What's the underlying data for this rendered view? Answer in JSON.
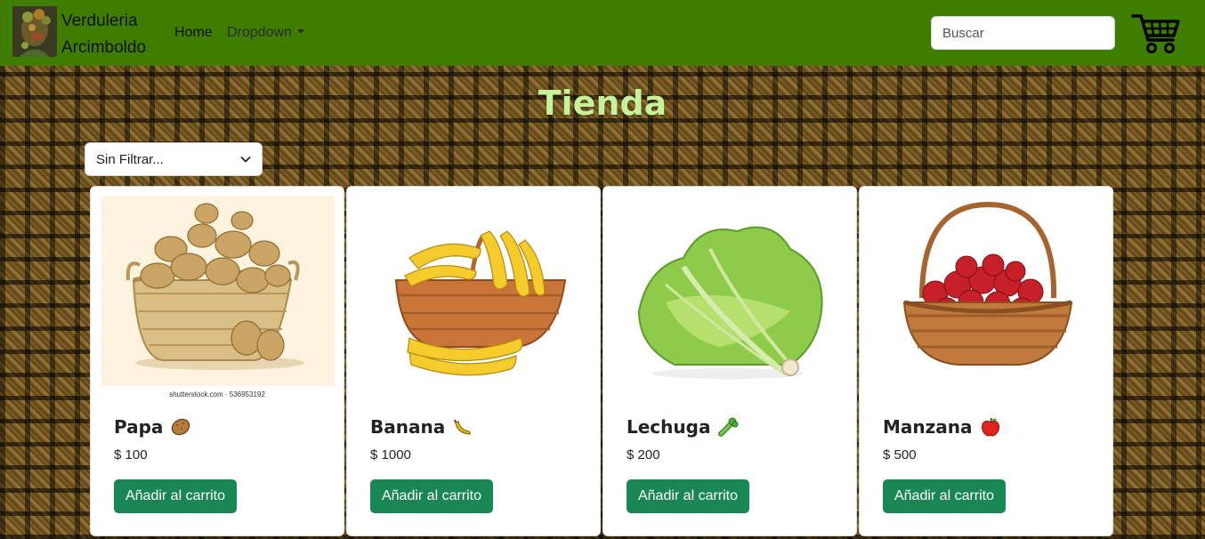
{
  "navbar": {
    "brand_line1": "Verduleria",
    "brand_line2": "Arcimboldo",
    "home_label": "Home",
    "dropdown_label": "Dropdown",
    "search_placeholder": "Buscar",
    "background_color": "#3f7d00"
  },
  "main": {
    "title": "Tienda",
    "filter_selected": "Sin Filtrar...",
    "image_watermark": "shutterstock.com · 536953192"
  },
  "products": [
    {
      "name": "Papa",
      "emoji_icon": "potato-icon",
      "price": "$ 100",
      "button_label": "Añadir al carrito"
    },
    {
      "name": "Banana",
      "emoji_icon": "banana-icon",
      "price": "$ 1000",
      "button_label": "Añadir al carrito"
    },
    {
      "name": "Lechuga",
      "emoji_icon": "celery-icon",
      "price": "$ 200",
      "button_label": "Añadir al carrito"
    },
    {
      "name": "Manzana",
      "emoji_icon": "apple-icon",
      "price": "$ 500",
      "button_label": "Añadir al carrito"
    }
  ],
  "colors": {
    "title": "#c8f29a",
    "button": "#198754"
  }
}
